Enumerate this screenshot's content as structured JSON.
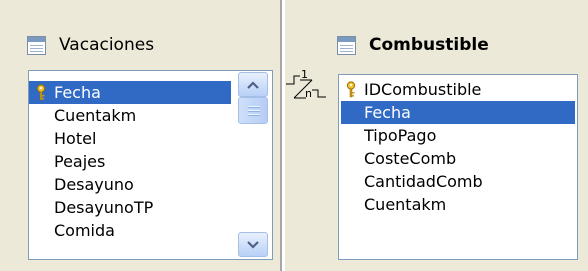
{
  "left_table": {
    "title": "Vacaciones",
    "fields": [
      "Fecha",
      "Cuentakm",
      "Hotel",
      "Peajes",
      "Desayuno",
      "DesayunoTP",
      "Comida"
    ],
    "selected": "Fecha",
    "primary_key": "Fecha"
  },
  "right_table": {
    "title": "Combustible",
    "fields": [
      "IDCombustible",
      "Fecha",
      "TipoPago",
      "CosteComb",
      "CantidadComb",
      "Cuentakm"
    ],
    "selected": "Fecha",
    "primary_key": "IDCombustible"
  },
  "relation": {
    "one_label": "1",
    "many_label": "n"
  },
  "colors": {
    "selection": "#316ac5",
    "background": "#ece9d8",
    "list_border": "#7f9db9"
  },
  "icons": {
    "table": "table-icon",
    "key": "key-icon",
    "scroll_up": "chevron-up-icon",
    "scroll_down": "chevron-down-icon"
  }
}
